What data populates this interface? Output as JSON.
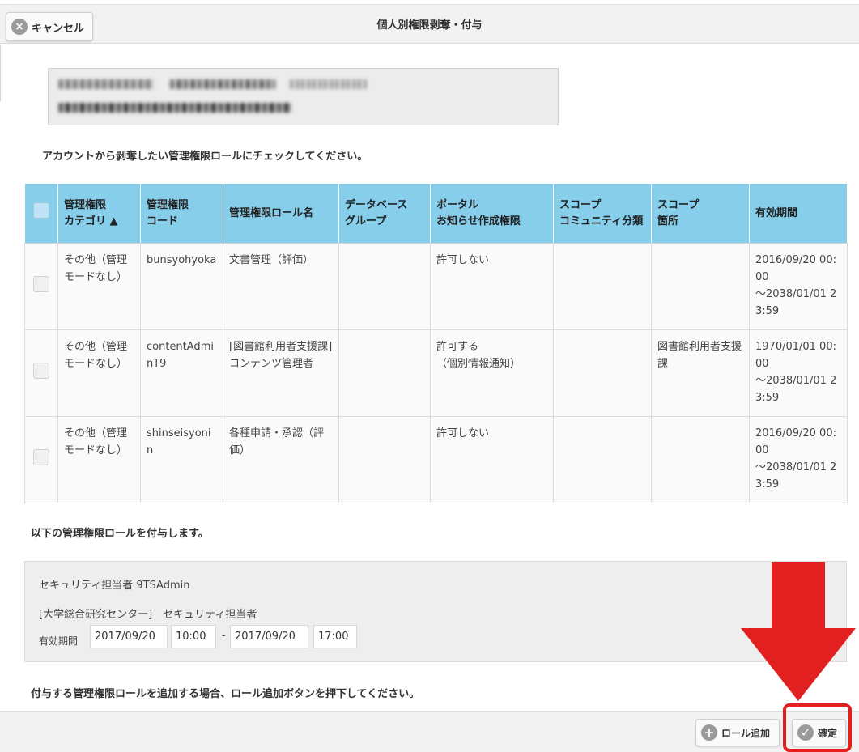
{
  "header": {
    "cancel_label": "キャンセル",
    "title": "個人別権限剥奪・付与"
  },
  "instructions": {
    "revoke": "アカウントから剥奪したい管理権限ロールにチェックしてください。",
    "grant": "以下の管理権限ロールを付与します。",
    "add": "付与する管理権限ロールを追加する場合、ロール追加ボタンを押下してください。"
  },
  "table": {
    "headers": {
      "category_line1": "管理権限",
      "category_line2": "カテゴリ ▲",
      "code_line1": "管理権限",
      "code_line2": "コード",
      "role_name": "管理権限ロール名",
      "db_line1": "データベース",
      "db_line2": "グループ",
      "portal_line1": "ポータル",
      "portal_line2": "お知らせ作成権限",
      "scope_comm_line1": "スコープ",
      "scope_comm_line2": "コミュニティ分類",
      "scope_place_line1": "スコープ",
      "scope_place_line2": "箇所",
      "period": "有効期間"
    },
    "rows": [
      {
        "category": "その他（管理モードなし）",
        "code": "bunsyohyoka",
        "role_name": "文書管理（評価）",
        "db_group": "",
        "portal_line1": "許可しない",
        "portal_line2": "",
        "scope_comm": "",
        "scope_place": "",
        "period_start": "2016/09/20 00:00",
        "period_end": "～2038/01/01 23:59"
      },
      {
        "category": "その他（管理モードなし）",
        "code": "contentAdminT9",
        "role_name": "[図書館利用者支援課]　コンテンツ管理者",
        "db_group": "",
        "portal_line1": "許可する",
        "portal_line2": "（個別情報通知）",
        "scope_comm": "",
        "scope_place": "図書館利用者支援課",
        "period_start": "1970/01/01 00:00",
        "period_end": "～2038/01/01 23:59"
      },
      {
        "category": "その他（管理モードなし）",
        "code": "shinseisyonin",
        "role_name": "各種申請・承認（評価）",
        "db_group": "",
        "portal_line1": "許可しない",
        "portal_line2": "",
        "scope_comm": "",
        "scope_place": "",
        "period_start": "2016/09/20 00:00",
        "period_end": "～2038/01/01 23:59"
      }
    ]
  },
  "grant": {
    "role_line": "セキュリティ担当者 9TSAdmin",
    "desc_line": "[大学総合研究センター]　セキュリティ担当者",
    "period_label": "有効期間",
    "start_date": "2017/09/20",
    "start_time": "10:00",
    "separator": "-",
    "end_date": "2017/09/20",
    "end_time": "17:00"
  },
  "footer": {
    "add_label": "ロール追加",
    "confirm_label": "確定"
  },
  "colors": {
    "table_header": "#87ceeb",
    "annotation_red": "#e32020"
  }
}
